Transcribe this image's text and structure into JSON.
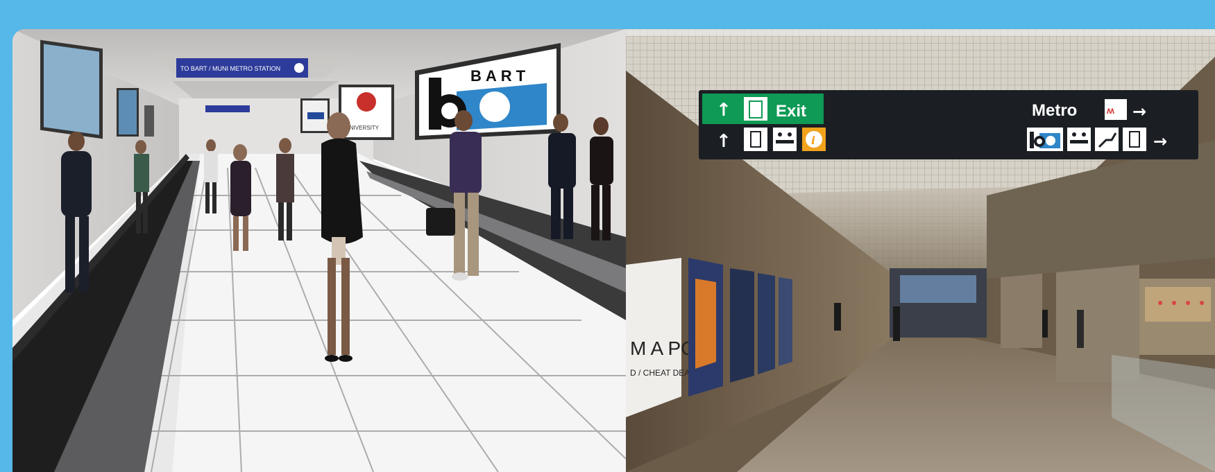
{
  "left_panel": {
    "ceiling_sign": "TO BART / MUNI METRO STATION",
    "billboard_bart": "BART",
    "billboard_university": "UNIVERSITY"
  },
  "right_panel": {
    "exit_sign": "Exit",
    "metro_sign": "Metro",
    "poster_text_1": "M A PC",
    "poster_text_2": "D / CHEAT DEATH"
  },
  "colors": {
    "background": "#55b8e8",
    "exit_green": "#0f9a55",
    "sign_dark": "#1b1f24",
    "bart_blue": "#2f86c9",
    "info_orange": "#f2a21c"
  },
  "icons": [
    "up-arrow-icon",
    "right-arrow-icon",
    "exit-door-icon",
    "elevator-icon",
    "ticket-counter-icon",
    "info-icon",
    "bart-logo-icon",
    "muni-logo-icon"
  ]
}
